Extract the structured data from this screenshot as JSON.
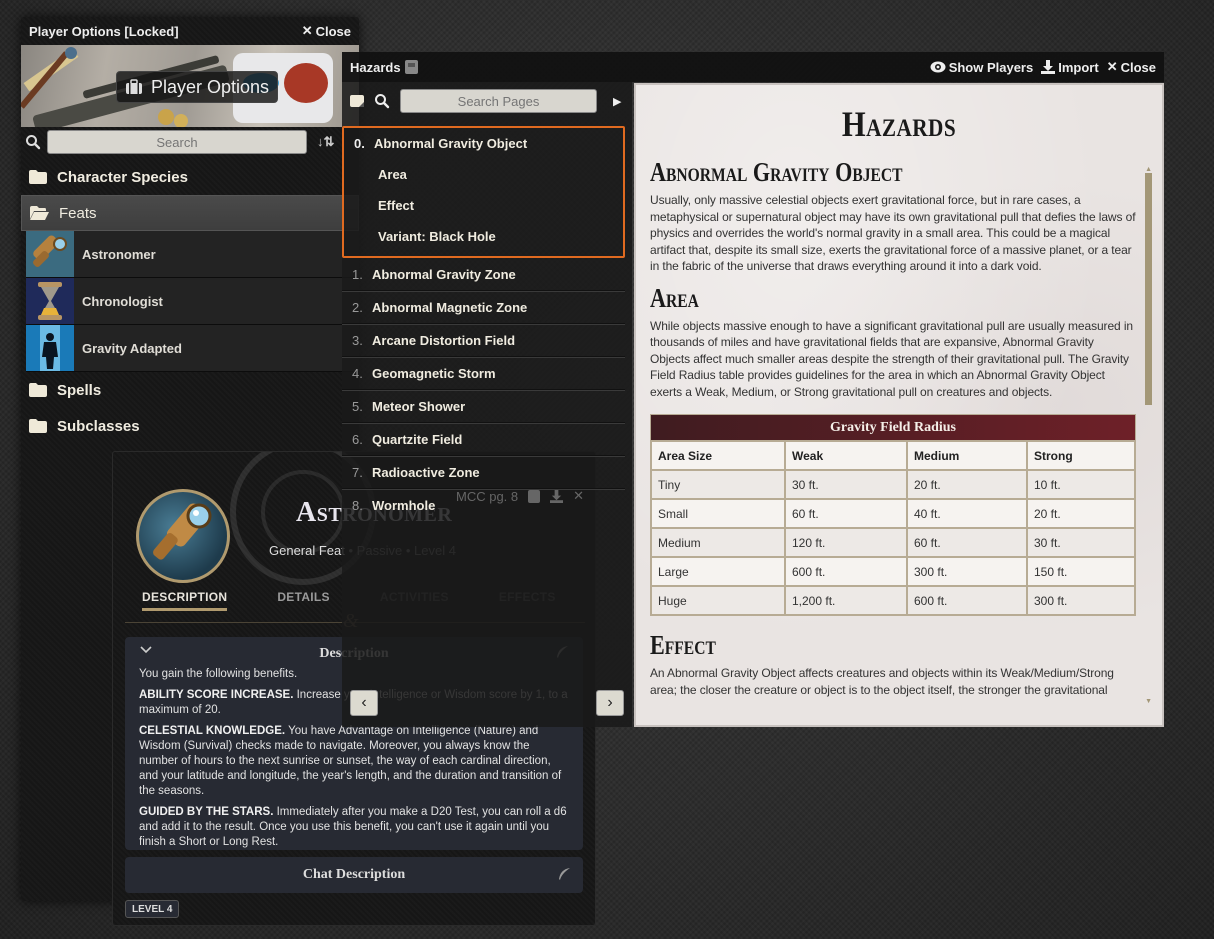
{
  "player_options": {
    "title": "Player Options [Locked]",
    "close_label": "Close",
    "banner_label": "Player Options",
    "search_placeholder": "Search",
    "folders": [
      {
        "label": "Character Species",
        "open": false
      },
      {
        "label": "Feats",
        "open": true
      },
      {
        "label": "Spells",
        "open": false
      },
      {
        "label": "Subclasses",
        "open": false
      }
    ],
    "feats": [
      {
        "name": "Astronomer",
        "icon": "spyglass-icon"
      },
      {
        "name": "Chronologist",
        "icon": "hourglass-icon"
      },
      {
        "name": "Gravity Adapted",
        "icon": "gravity-figure-icon"
      }
    ]
  },
  "feat_sheet": {
    "title": "Astronomer",
    "type": "General Feat",
    "activation": "Passive",
    "level_text": "Level 4",
    "tabs": [
      "DESCRIPTION",
      "DETAILS",
      "ACTIVITIES",
      "EFFECTS"
    ],
    "active_tab": "DESCRIPTION",
    "description_title": "Description",
    "intro": "You gain the following benefits.",
    "benefits": [
      {
        "name": "ABILITY SCORE INCREASE.",
        "text": " Increase your Intelligence or Wisdom score by 1, to a maximum of 20."
      },
      {
        "name": "CELESTIAL KNOWLEDGE.",
        "text": " You have Advantage on Intelligence (Nature) and Wisdom (Survival) checks made to navigate. Moreover, you always know the number of hours to the next sunrise or sunset, the way of each cardinal direction, and your latitude and longitude, the year's length, and the duration and transition of the seasons."
      },
      {
        "name": "GUIDED BY THE STARS.",
        "text": " Immediately after you make a D20 Test, you can roll a d6 and add it to the result. Once you use this benefit, you can't use it again until you finish a Short or Long Rest."
      }
    ],
    "chat_description_title": "Chat Description",
    "level_badge": "LEVEL 4"
  },
  "hazards": {
    "title": "Hazards",
    "actions": {
      "show_players": "Show Players",
      "import": "Import",
      "close": "Close"
    },
    "search_placeholder": "Search Pages",
    "page_ref": "MCC pg. 8",
    "toc": [
      {
        "num": "0.",
        "label": "Abnormal Gravity Object",
        "active": true,
        "subs": [
          "Area",
          "Effect",
          "Variant: Black Hole"
        ]
      },
      {
        "num": "1.",
        "label": "Abnormal Gravity Zone"
      },
      {
        "num": "2.",
        "label": "Abnormal Magnetic Zone"
      },
      {
        "num": "3.",
        "label": "Arcane Distortion Field"
      },
      {
        "num": "4.",
        "label": "Geomagnetic Storm"
      },
      {
        "num": "5.",
        "label": "Meteor Shower"
      },
      {
        "num": "6.",
        "label": "Quartzite Field"
      },
      {
        "num": "7.",
        "label": "Radioactive Zone"
      },
      {
        "num": "8.",
        "label": "Wormhole"
      }
    ],
    "page": {
      "heading": "Hazards",
      "section_title": "Abnormal Gravity Object",
      "intro": "Usually, only massive celestial objects exert gravitational force, but in rare cases, a metaphysical or supernatural object may have its own gravitational pull that defies the laws of physics and overrides the world's normal gravity in a small area. This could be a magical artifact that, despite its small size, exerts the gravitational force of a massive planet, or a tear in the fabric of the universe that draws everything around it into a dark void.",
      "area_title": "Area",
      "area_text": "While objects massive enough to have a significant gravitational pull are usually measured in thousands of miles and have gravitational fields that are expansive, Abnormal Gravity Objects affect much smaller areas despite the strength of their gravitational pull. The Gravity Field Radius table provides guidelines for the area in which an Abnormal Gravity Object exerts a Weak, Medium, or Strong gravitational pull on creatures and objects.",
      "table": {
        "caption": "Gravity Field Radius",
        "headers": [
          "Area Size",
          "Weak",
          "Medium",
          "Strong"
        ],
        "rows": [
          [
            "Tiny",
            "30 ft.",
            "20 ft.",
            "10 ft."
          ],
          [
            "Small",
            "60 ft.",
            "40 ft.",
            "20 ft."
          ],
          [
            "Medium",
            "120 ft.",
            "60 ft.",
            "30 ft."
          ],
          [
            "Large",
            "600 ft.",
            "300 ft.",
            "150 ft."
          ],
          [
            "Huge",
            "1,200 ft.",
            "600 ft.",
            "300 ft."
          ]
        ]
      },
      "effect_title": "Effect",
      "effect_text": "An Abnormal Gravity Object affects creatures and objects within its Weak/Medium/Strong area; the closer the creature or object is to the object itself, the stronger the gravitational"
    }
  },
  "colors": {
    "highlight_border": "#e06a20",
    "table_header": "#6e2028",
    "tab_underline": "#b09a6e"
  }
}
